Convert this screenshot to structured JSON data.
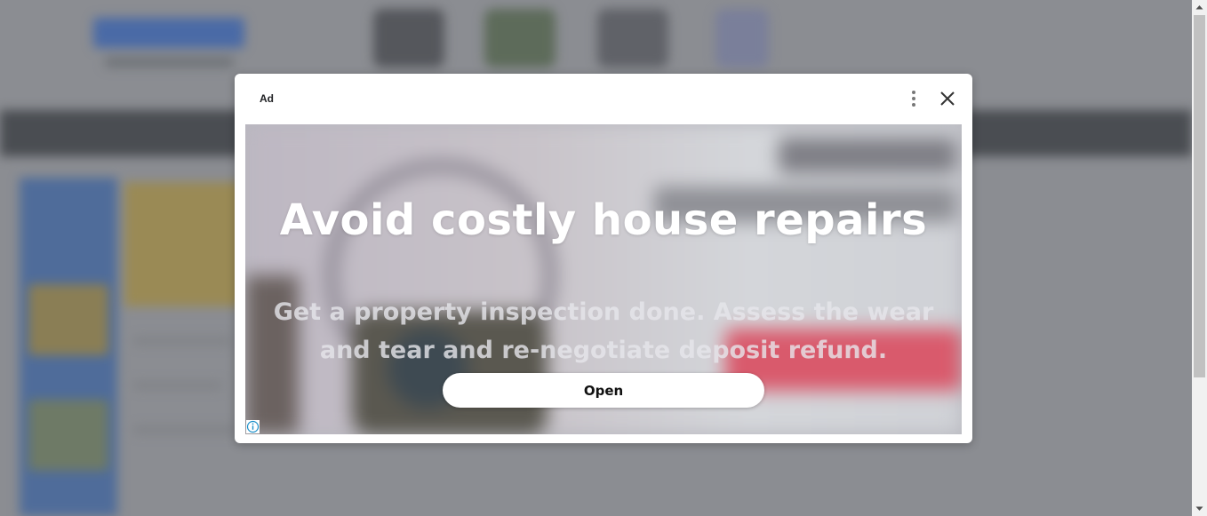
{
  "ad_dialog": {
    "label": "Ad",
    "headline": "Avoid costly house repairs",
    "body": "Get a property inspection done. Assess the wear and tear and re-negotiate deposit refund.",
    "cta_label": "Open",
    "icons": {
      "menu": "more-vert-icon",
      "close": "close-icon",
      "info": "ad-info-icon"
    }
  },
  "colors": {
    "overlay_background": "#8b8d92",
    "dialog_background": "#ffffff",
    "headline_text": "#ffffff",
    "cta_background": "#ffffff",
    "info_icon": "#1a8fc9"
  }
}
